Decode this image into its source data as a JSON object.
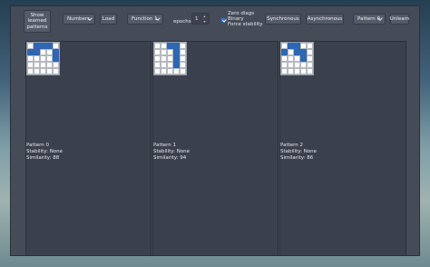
{
  "toolbar": {
    "show_learned_label": "Show\nlearned\npatterns",
    "mode_combo": "Numbers",
    "load_label": "Load",
    "function_combo": "Function 1",
    "epochs_label": "epochs",
    "epochs_value": "1",
    "zero_diags_label": "Zero diags",
    "binary_label": "Binary",
    "force_stability_label": "Force stability",
    "synchronous_label": "Synchronous",
    "asynchronous_label": "Asynchronous",
    "pattern_combo": "Pattern 0",
    "unlearn_label": "Unlearn"
  },
  "colors": {
    "cell_on": "#2f66b1",
    "cell_off": "#ffffff",
    "panel_bg": "#3b404d",
    "window_bg": "#464b58"
  },
  "patterns": [
    {
      "title": "Pattern 0",
      "stability": "Stability: None",
      "similarity": "Similarity: 88",
      "grid": [
        [
          0,
          1,
          1,
          1,
          0
        ],
        [
          1,
          1,
          0,
          0,
          1
        ],
        [
          0,
          0,
          0,
          0,
          1
        ],
        [
          0,
          0,
          0,
          0,
          0
        ],
        [
          0,
          0,
          0,
          0,
          0
        ]
      ]
    },
    {
      "title": "Pattern 1",
      "stability": "Stability: None",
      "similarity": "Similarity: 94",
      "grid": [
        [
          0,
          0,
          1,
          1,
          0
        ],
        [
          0,
          0,
          0,
          1,
          0
        ],
        [
          0,
          0,
          0,
          1,
          0
        ],
        [
          0,
          0,
          0,
          1,
          0
        ],
        [
          0,
          0,
          0,
          0,
          0
        ]
      ]
    },
    {
      "title": "Pattern 2",
      "stability": "Stability: None",
      "similarity": "Similarity: 86",
      "grid": [
        [
          0,
          1,
          1,
          0,
          0
        ],
        [
          1,
          0,
          1,
          1,
          0
        ],
        [
          0,
          0,
          0,
          1,
          0
        ],
        [
          0,
          0,
          0,
          0,
          0
        ],
        [
          0,
          0,
          0,
          0,
          0
        ]
      ]
    }
  ]
}
